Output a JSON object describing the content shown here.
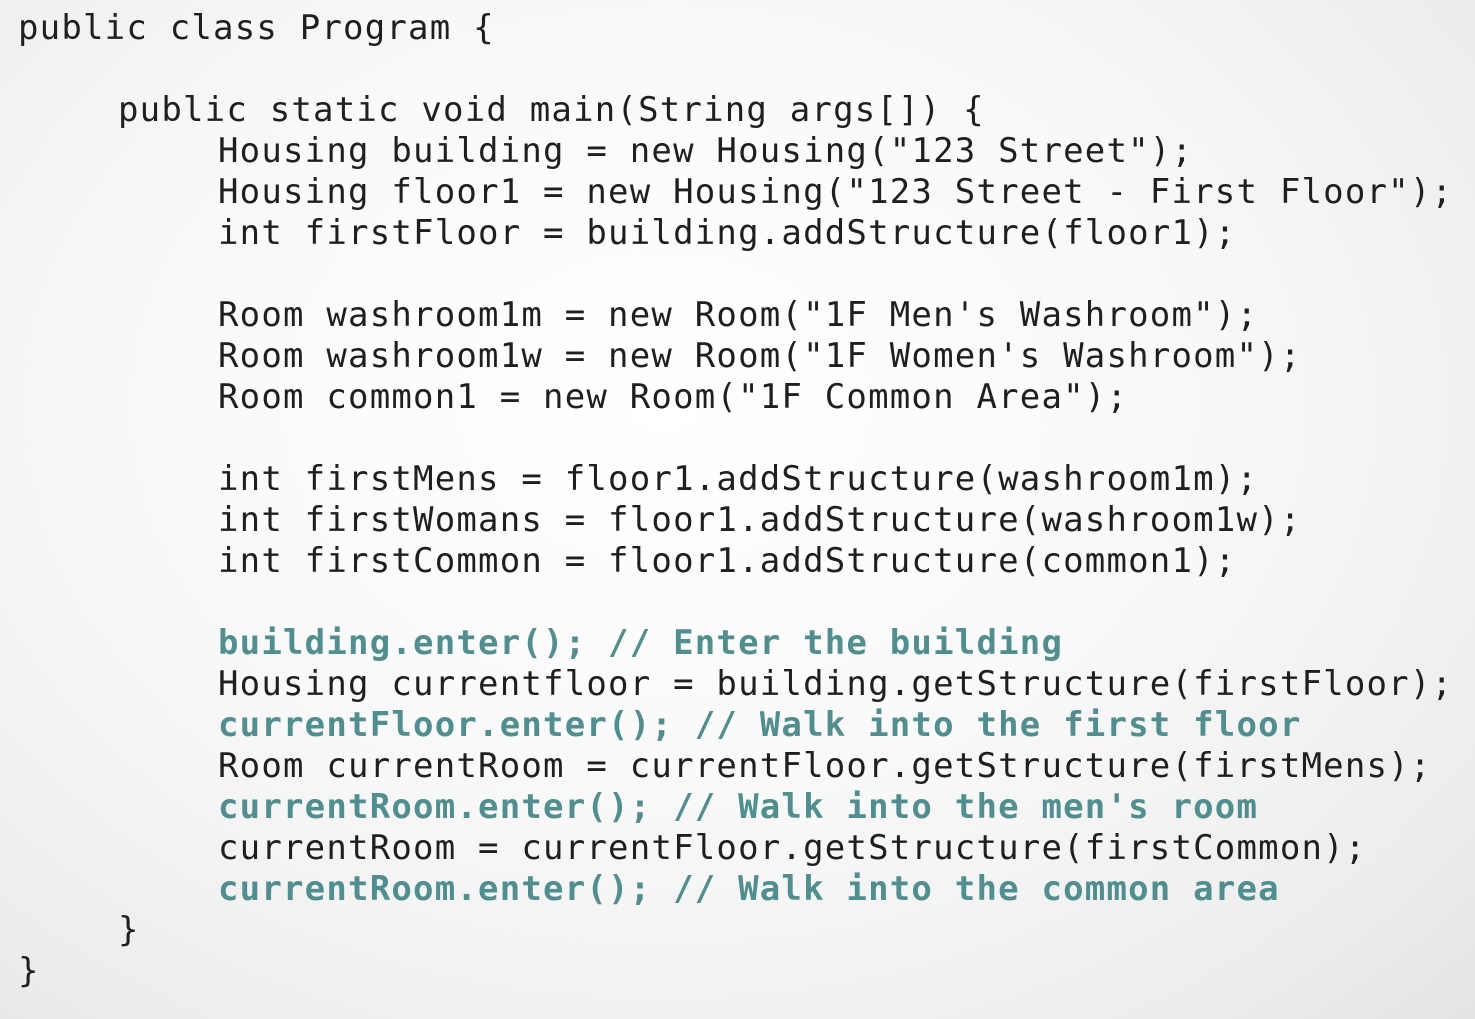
{
  "code": {
    "lines": [
      {
        "text": "public class Program {",
        "highlight": false
      },
      {
        "text": "",
        "highlight": false
      },
      {
        "text": "public static void main(String args[]) {",
        "highlight": false
      },
      {
        "text": "Housing building = new Housing(\"123 Street\");",
        "highlight": false
      },
      {
        "text": "Housing floor1 = new Housing(\"123 Street - First Floor\");",
        "highlight": false
      },
      {
        "text": "int firstFloor = building.addStructure(floor1);",
        "highlight": false
      },
      {
        "text": "",
        "highlight": false
      },
      {
        "text": "Room washroom1m = new Room(\"1F Men's Washroom\");",
        "highlight": false
      },
      {
        "text": "Room washroom1w = new Room(\"1F Women's Washroom\");",
        "highlight": false
      },
      {
        "text": "Room common1 = new Room(\"1F Common Area\");",
        "highlight": false
      },
      {
        "text": "",
        "highlight": false
      },
      {
        "text": "int firstMens = floor1.addStructure(washroom1m);",
        "highlight": false
      },
      {
        "text": "int firstWomans = floor1.addStructure(washroom1w);",
        "highlight": false
      },
      {
        "text": "int firstCommon = floor1.addStructure(common1);",
        "highlight": false
      },
      {
        "text": "",
        "highlight": false
      },
      {
        "text": "building.enter(); // Enter the building",
        "highlight": true
      },
      {
        "text": "Housing currentfloor = building.getStructure(firstFloor);",
        "highlight": false
      },
      {
        "text": "currentFloor.enter(); // Walk into the first floor",
        "highlight": true
      },
      {
        "text": "Room currentRoom = currentFloor.getStructure(firstMens);",
        "highlight": false
      },
      {
        "text": "currentRoom.enter(); // Walk into the men's room",
        "highlight": true
      },
      {
        "text": "currentRoom = currentFloor.getStructure(firstCommon);",
        "highlight": false
      },
      {
        "text": "currentRoom.enter(); // Walk into the common area",
        "highlight": true
      },
      {
        "text": "}",
        "highlight": false
      },
      {
        "text": "}",
        "highlight": false
      }
    ],
    "colors": {
      "text": "#1f1f1f",
      "comment": "#4f8f8f",
      "background": "#f5f5f5"
    }
  }
}
